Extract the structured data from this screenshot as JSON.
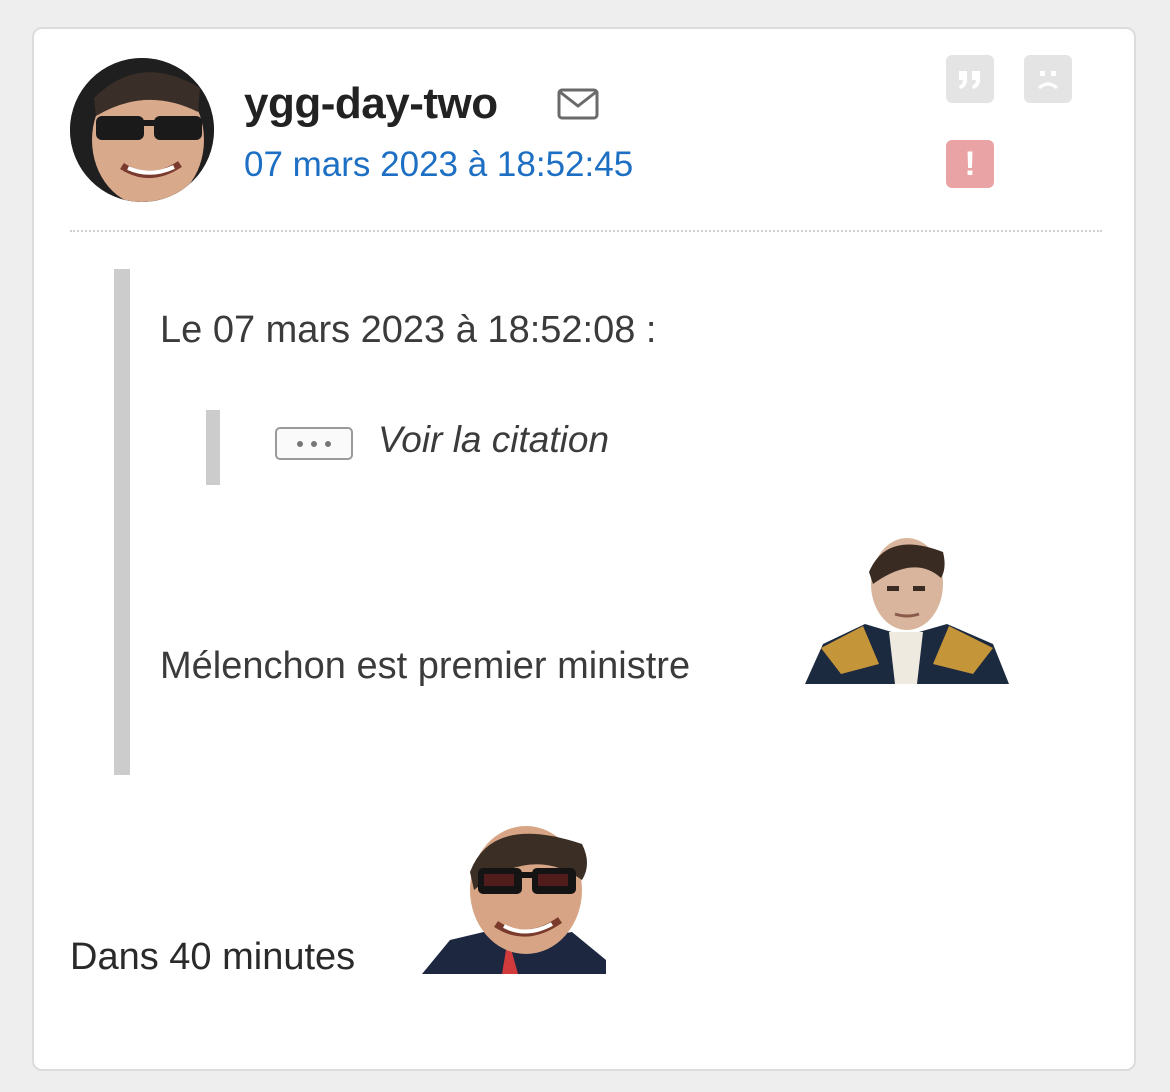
{
  "post": {
    "author": "ygg-day-two",
    "timestamp": "07 mars 2023 à 18:52:45",
    "actions": {
      "quote_icon": "quote-icon",
      "sad_icon": "sad-face-icon",
      "report_icon": "exclamation-icon",
      "report_glyph": "!"
    },
    "colors": {
      "timestamp": "#1d6fc4",
      "report": "#eaa3a5",
      "action_bg": "#e4e4e4"
    }
  },
  "quote": {
    "header": "Le 07 mars 2023 à 18:52:08 :",
    "nested_link": "Voir la citation",
    "text": "Mélenchon est premier ministre"
  },
  "message": {
    "text": "Dans 40 minutes"
  }
}
